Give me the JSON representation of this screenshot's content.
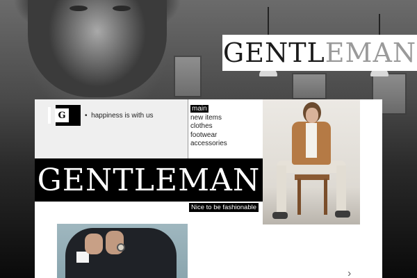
{
  "header": {
    "banner_title": "GENTLEMAN",
    "banner_title_start": "GENTL",
    "banner_title_end": "EMAN",
    "logo_letter": "G",
    "tagline": "happiness is with us"
  },
  "menu": {
    "items": [
      {
        "label": "main",
        "active": true
      },
      {
        "label": "new items",
        "active": false
      },
      {
        "label": "clothes",
        "active": false
      },
      {
        "label": "footwear",
        "active": false
      },
      {
        "label": "accessories",
        "active": false
      }
    ]
  },
  "hero": {
    "title": "GENTLEMAN",
    "slogan": "Nice to be fashionable"
  },
  "icons": {
    "logo": "logo-icon",
    "next": "chevron-right-icon"
  },
  "colors": {
    "primary": "#000000",
    "background": "#ffffff",
    "panel": "#efefef",
    "accent_jacket": "#b57a45"
  }
}
